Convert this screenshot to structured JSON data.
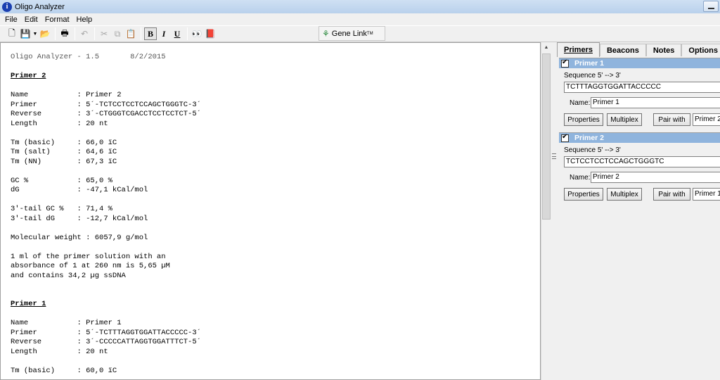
{
  "window": {
    "title": "Oligo Analyzer"
  },
  "menu": [
    "File",
    "Edit",
    "Format",
    "Help"
  ],
  "toolbar": {
    "gene_link": "Gene Link",
    "gene_link_tm": "TM"
  },
  "report": {
    "header": "Oligo Analyzer - 1.5       8/2/2015",
    "primer2_heading": "Primer 2",
    "primer2_block1": "Name           : Primer 2\nPrimer         : 5´-TCTCCTCCTCCAGCTGGGTC-3´\nReverse        : 3´-CTGGGTCGACCTCCTCCTCT-5´\nLength         : 20 nt\n\nTm (basic)     : 66,0 ïC\nTm (salt)      : 64,6 ïC\nTm (NN)        : 67,3 ïC\n\nGC %           : 65,0 %\ndG             : -47,1 kCal/mol\n\n3'-tail GC %   : 71,4 %\n3'-tail dG     : -12,7 kCal/mol\n\nMolecular weight : 6057,9 g/mol\n\n1 ml of the primer solution with an\nabsorbance of 1 at 260 nm is 5,65 µM\nand contains 34,2 µg ssDNA",
    "primer1_heading": "Primer 1",
    "primer1_block1": "Name           : Primer 1\nPrimer         : 5´-TCTTTAGGTGGATTACCCCC-3´\nReverse        : 3´-CCCCCATTAGGTGGATTTCT-5´\nLength         : 20 nt\n\nTm (basic)     : 60,0 ïC"
  },
  "tabs": [
    "Primers",
    "Beacons",
    "Notes",
    "Options"
  ],
  "primers": [
    {
      "header": "Primer 1",
      "sequence_label": "Sequence  5' --> 3'",
      "sequence": "TCTTTAGGTGGATTACCCCC",
      "name_label": "Name:",
      "name": "Primer 1",
      "properties": "Properties",
      "multiplex": "Multiplex",
      "pair_with": "Pair with",
      "pair_value": "Primer 2"
    },
    {
      "header": "Primer 2",
      "sequence_label": "Sequence  5' --> 3'",
      "sequence": "TCTCCTCCTCCAGCTGGGTC",
      "name_label": "Name:",
      "name": "Primer 2",
      "properties": "Properties",
      "multiplex": "Multiplex",
      "pair_with": "Pair with",
      "pair_value": "Primer 1"
    }
  ]
}
